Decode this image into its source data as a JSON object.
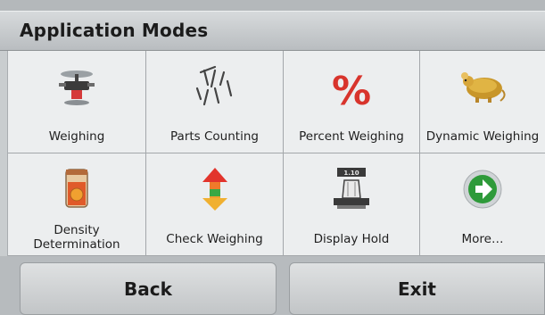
{
  "header": {
    "title": "Application Modes"
  },
  "modes": [
    {
      "label": "Weighing",
      "icon": "scale-pan-icon"
    },
    {
      "label": "Parts Counting",
      "icon": "nails-icon"
    },
    {
      "label": "Percent Weighing",
      "icon": "percent-icon"
    },
    {
      "label": "Dynamic Weighing",
      "icon": "mouse-animal-icon"
    },
    {
      "label": "Density\nDetermination",
      "icon": "beaker-icon"
    },
    {
      "label": "Check Weighing",
      "icon": "up-down-arrow-icon"
    },
    {
      "label": "Display Hold",
      "icon": "display-hold-scale-icon"
    },
    {
      "label": "More…",
      "icon": "green-arrow-icon"
    }
  ],
  "display_hold_icon_text": "1.10",
  "buttons": {
    "back": "Back",
    "exit": "Exit"
  },
  "colors": {
    "background": "#c9cdcf",
    "percent": "#d8342c",
    "more_arrow": "#2e9a3a"
  }
}
